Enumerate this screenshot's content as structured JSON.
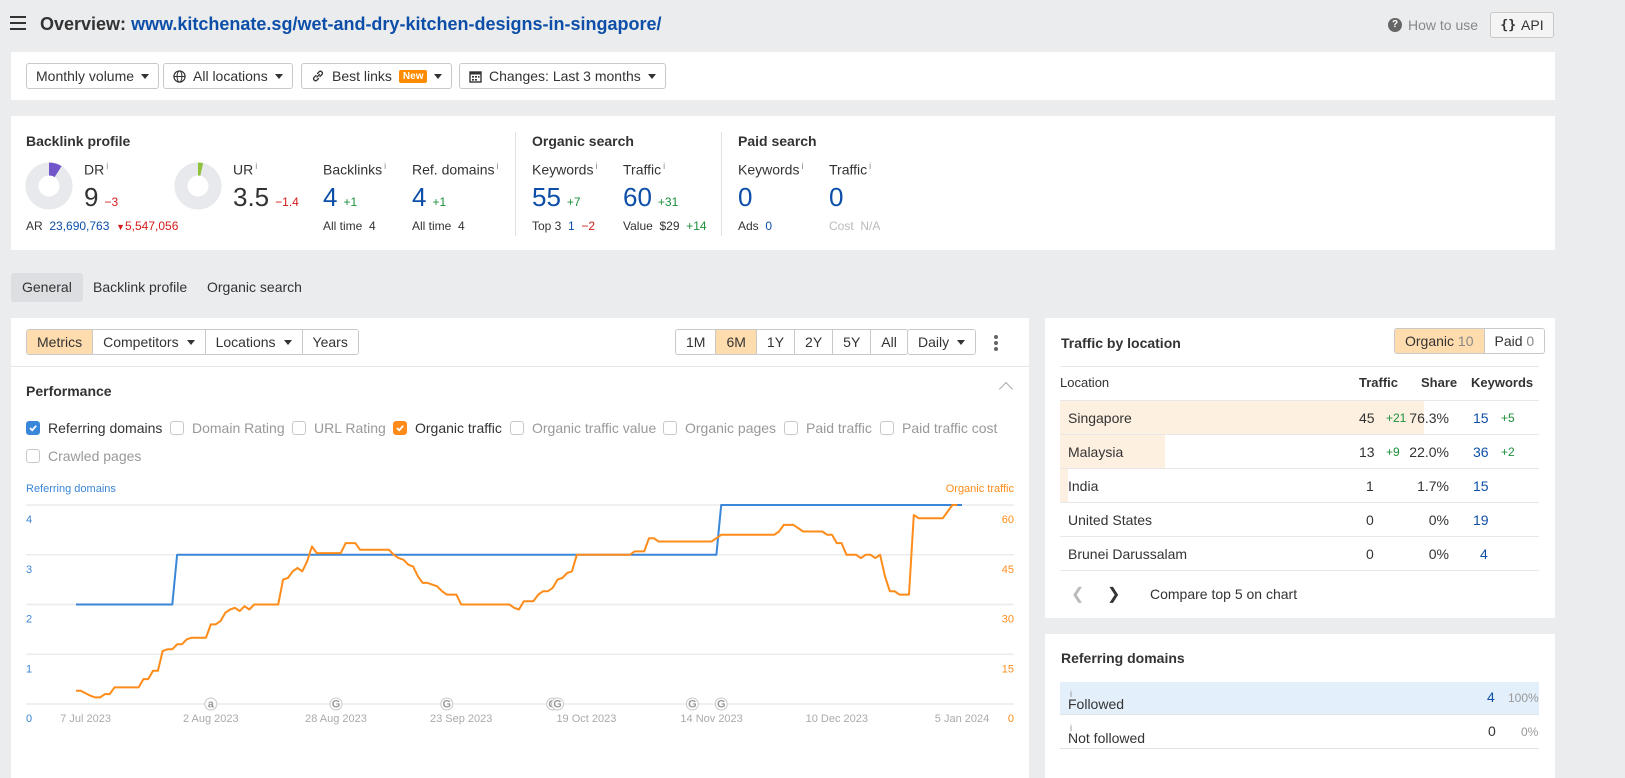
{
  "header": {
    "title_prefix": "Overview:",
    "url": "www.kitchenate.sg/wet-and-dry-kitchen-designs-in-singapore/",
    "how_to_use": "How to use",
    "api_label": "API",
    "api_icon": "{}"
  },
  "filters": {
    "volume": "Monthly volume",
    "locations": "All locations",
    "links": "Best links",
    "links_badge": "New",
    "changes": "Changes: Last 3 months"
  },
  "backlink_profile": {
    "title": "Backlink profile",
    "dr": {
      "label": "DR",
      "value": "9",
      "delta": "−3",
      "fill": 0.09,
      "color": "#7056c8"
    },
    "ur": {
      "label": "UR",
      "value": "3.5",
      "delta": "−1.4",
      "fill": 0.035,
      "color": "#8fc13a"
    },
    "ar": {
      "label": "AR",
      "value": "23,690,763",
      "delta": "5,547,056"
    },
    "backlinks": {
      "label": "Backlinks",
      "value": "4",
      "delta": "+1",
      "sub_label": "All time",
      "sub_value": "4"
    },
    "ref_domains": {
      "label": "Ref. domains",
      "value": "4",
      "delta": "+1",
      "sub_label": "All time",
      "sub_value": "4"
    }
  },
  "organic_search": {
    "title": "Organic search",
    "keywords": {
      "label": "Keywords",
      "value": "55",
      "delta": "+7",
      "sub_label": "Top 3",
      "sub_value": "1",
      "sub_delta": "−2"
    },
    "traffic": {
      "label": "Traffic",
      "value": "60",
      "delta": "+31",
      "sub_label": "Value",
      "sub_value": "$29",
      "sub_delta": "+14"
    }
  },
  "paid_search": {
    "title": "Paid search",
    "keywords": {
      "label": "Keywords",
      "value": "0",
      "sub_label": "Ads",
      "sub_value": "0"
    },
    "traffic": {
      "label": "Traffic",
      "value": "0",
      "sub_label": "Cost",
      "sub_value": "N/A"
    }
  },
  "info_mark": "i",
  "tabs": [
    "General",
    "Backlink profile",
    "Organic search"
  ],
  "chart_toolbar": {
    "modes": [
      "Metrics",
      "Competitors",
      "Locations",
      "Years"
    ],
    "ranges": [
      "1M",
      "6M",
      "1Y",
      "2Y",
      "5Y",
      "All"
    ],
    "active_range": "6M",
    "interval": "Daily"
  },
  "performance": {
    "title": "Performance",
    "checkboxes": [
      {
        "label": "Referring domains",
        "checked": true,
        "color": "blue"
      },
      {
        "label": "Domain Rating",
        "checked": false
      },
      {
        "label": "URL Rating",
        "checked": false
      },
      {
        "label": "Organic traffic",
        "checked": true,
        "color": "orange"
      },
      {
        "label": "Organic traffic value",
        "checked": false
      },
      {
        "label": "Organic pages",
        "checked": false
      },
      {
        "label": "Paid traffic",
        "checked": false
      },
      {
        "label": "Paid traffic cost",
        "checked": false
      },
      {
        "label": "Crawled pages",
        "checked": false
      }
    ]
  },
  "chart_data": {
    "type": "line",
    "title": "Performance",
    "x_start": "2023-07-05",
    "x_end": "2024-01-05",
    "x_tick_labels": [
      "7 Jul 2023",
      "2 Aug 2023",
      "28 Aug 2023",
      "23 Sep 2023",
      "19 Oct 2023",
      "14 Nov 2023",
      "10 Dec 2023",
      "5 Jan 2024"
    ],
    "x_tick_days": [
      2,
      28,
      54,
      80,
      106,
      132,
      158,
      184
    ],
    "y_left": {
      "label": "Referring domains",
      "ticks": [
        0,
        1,
        2,
        3,
        4
      ],
      "range": [
        0,
        4
      ],
      "color": "#3a86d8"
    },
    "y_right": {
      "label": "Organic traffic",
      "ticks": [
        0,
        15,
        30,
        45,
        60
      ],
      "range": [
        0,
        60
      ],
      "color": "#ff8c1a"
    },
    "grid": true,
    "series": [
      {
        "name": "Referring domains",
        "axis": "left",
        "color": "#3a86d8",
        "step": true,
        "points": [
          [
            0,
            2
          ],
          [
            20,
            2
          ],
          [
            21,
            3
          ],
          [
            133,
            3
          ],
          [
            134,
            4
          ],
          [
            184,
            4
          ]
        ]
      },
      {
        "name": "Organic traffic",
        "axis": "right",
        "color": "#ff8c1a",
        "points": [
          [
            0,
            4
          ],
          [
            1,
            4
          ],
          [
            3,
            2.5
          ],
          [
            4,
            2
          ],
          [
            5,
            2
          ],
          [
            6,
            3
          ],
          [
            7,
            3
          ],
          [
            8,
            5
          ],
          [
            9,
            5
          ],
          [
            12,
            5
          ],
          [
            13,
            5
          ],
          [
            14,
            7.5
          ],
          [
            15,
            7.5
          ],
          [
            16,
            10
          ],
          [
            17,
            10
          ],
          [
            18,
            16
          ],
          [
            19,
            16.5
          ],
          [
            20,
            16.5
          ],
          [
            21,
            18
          ],
          [
            22,
            18
          ],
          [
            23,
            19.5
          ],
          [
            24,
            20
          ],
          [
            25,
            20
          ],
          [
            26,
            20
          ],
          [
            27,
            20
          ],
          [
            28,
            24
          ],
          [
            29,
            24
          ],
          [
            30,
            25
          ],
          [
            31,
            27.5
          ],
          [
            32,
            28.5
          ],
          [
            33,
            29
          ],
          [
            34,
            28
          ],
          [
            35,
            29.5
          ],
          [
            36,
            28.5
          ],
          [
            37,
            30
          ],
          [
            38,
            30
          ],
          [
            40,
            30
          ],
          [
            41,
            30
          ],
          [
            42,
            30
          ],
          [
            43,
            37.5
          ],
          [
            44,
            38
          ],
          [
            45,
            40
          ],
          [
            46,
            41
          ],
          [
            47,
            40
          ],
          [
            48,
            43
          ],
          [
            49,
            47.5
          ],
          [
            50,
            45.5
          ],
          [
            51,
            45.5
          ],
          [
            52,
            45.5
          ],
          [
            55,
            45.5
          ],
          [
            56,
            48.5
          ],
          [
            57,
            48.5
          ],
          [
            58,
            48.5
          ],
          [
            59,
            46.5
          ],
          [
            60,
            46.5
          ],
          [
            61,
            46.5
          ],
          [
            64,
            46.5
          ],
          [
            65,
            46.5
          ],
          [
            66,
            45
          ],
          [
            67,
            44
          ],
          [
            68,
            43.5
          ],
          [
            69,
            42
          ],
          [
            70,
            41.5
          ],
          [
            71,
            38.5
          ],
          [
            72,
            36.5
          ],
          [
            73,
            36.5
          ],
          [
            75,
            35.5
          ],
          [
            76,
            34
          ],
          [
            77,
            33
          ],
          [
            78,
            33
          ],
          [
            79,
            33
          ],
          [
            80,
            30
          ],
          [
            81,
            30
          ],
          [
            90,
            30
          ],
          [
            91,
            29
          ],
          [
            92,
            28.5
          ],
          [
            93,
            31
          ],
          [
            94,
            31
          ],
          [
            95,
            31
          ],
          [
            96,
            33
          ],
          [
            97,
            34
          ],
          [
            98,
            34
          ],
          [
            99,
            35
          ],
          [
            100,
            37.5
          ],
          [
            101,
            38
          ],
          [
            102,
            39.5
          ],
          [
            103,
            40
          ],
          [
            104,
            45
          ],
          [
            105,
            45
          ],
          [
            115,
            45
          ],
          [
            116,
            46
          ],
          [
            117,
            46
          ],
          [
            118,
            46
          ],
          [
            119,
            50
          ],
          [
            120,
            50
          ],
          [
            121,
            49
          ],
          [
            132,
            49
          ],
          [
            133,
            50
          ],
          [
            134,
            51
          ],
          [
            145,
            51
          ],
          [
            146,
            52
          ],
          [
            147,
            54
          ],
          [
            148,
            54
          ],
          [
            149,
            54
          ],
          [
            150,
            53
          ],
          [
            151,
            52
          ],
          [
            152,
            52
          ],
          [
            155,
            52
          ],
          [
            156,
            51
          ],
          [
            157,
            51
          ],
          [
            158,
            48.5
          ],
          [
            159,
            48.5
          ],
          [
            160,
            45
          ],
          [
            161,
            45
          ],
          [
            162,
            45
          ],
          [
            163,
            44
          ],
          [
            164,
            45
          ],
          [
            165,
            45
          ],
          [
            166,
            44
          ],
          [
            167,
            45
          ],
          [
            168,
            38.5
          ],
          [
            169,
            34
          ],
          [
            170,
            34
          ],
          [
            171,
            33
          ],
          [
            172,
            33
          ],
          [
            173,
            33
          ],
          [
            174,
            57
          ],
          [
            175,
            56
          ],
          [
            180,
            56
          ],
          [
            181,
            58
          ],
          [
            182,
            60
          ],
          [
            183,
            60
          ]
        ]
      }
    ],
    "annotations": [
      {
        "day": 28,
        "label": "a"
      },
      {
        "day": 54,
        "label": "G"
      },
      {
        "day": 77,
        "label": "G"
      },
      {
        "day": 99,
        "label": "G"
      },
      {
        "day": 100,
        "label": "G"
      },
      {
        "day": 128,
        "label": "G"
      },
      {
        "day": 134,
        "label": "G"
      }
    ]
  },
  "traffic_by_location": {
    "title": "Traffic by location",
    "toggle": [
      {
        "label": "Organic",
        "count": "10",
        "active": true
      },
      {
        "label": "Paid",
        "count": "0",
        "active": false
      }
    ],
    "columns": [
      "Location",
      "Traffic",
      "Share",
      "Keywords"
    ],
    "rows": [
      {
        "location": "Singapore",
        "traffic": "45",
        "traffic_delta": "+21",
        "share": "76.3%",
        "share_value": 0.763,
        "keywords": "15",
        "keywords_delta": "+5"
      },
      {
        "location": "Malaysia",
        "traffic": "13",
        "traffic_delta": "+9",
        "share": "22.0%",
        "share_value": 0.22,
        "keywords": "36",
        "keywords_delta": "+2"
      },
      {
        "location": "India",
        "traffic": "1",
        "traffic_delta": "",
        "share": "1.7%",
        "share_value": 0.017,
        "keywords": "15",
        "keywords_delta": ""
      },
      {
        "location": "United States",
        "traffic": "0",
        "traffic_delta": "",
        "share": "0%",
        "share_value": 0,
        "keywords": "19",
        "keywords_delta": ""
      },
      {
        "location": "Brunei Darussalam",
        "traffic": "0",
        "traffic_delta": "",
        "share": "0%",
        "share_value": 0,
        "keywords": "4",
        "keywords_delta": ""
      }
    ],
    "compare_label": "Compare top 5 on chart"
  },
  "referring_domains_card": {
    "title": "Referring domains",
    "rows": [
      {
        "label": "Followed",
        "value": "4",
        "pct": "100%"
      },
      {
        "label": "Not followed",
        "value": "0",
        "pct": "0%"
      }
    ]
  }
}
